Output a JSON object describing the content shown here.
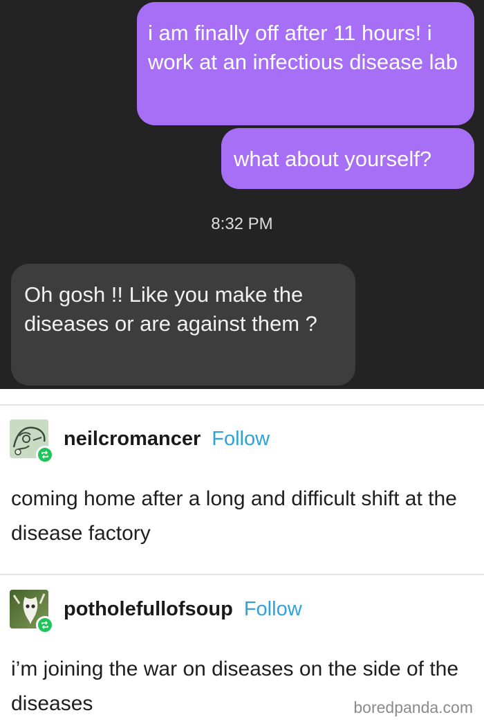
{
  "chat": {
    "messages": [
      {
        "direction": "sent",
        "text": "i am finally off after 11 hours! i work at an infectious disease lab"
      },
      {
        "direction": "sent",
        "text": "what about yourself?"
      },
      {
        "direction": "received",
        "text": "Oh gosh !! Like you make the diseases or are against them ?"
      }
    ],
    "timestamp": "8:32 PM",
    "colors": {
      "sent_bubble": "#a66ff5",
      "received_bubble": "#3d3d3d",
      "background": "#232323"
    }
  },
  "posts": [
    {
      "username": "neilcromancer",
      "follow_label": "Follow",
      "avatar_icon": "anime-character-avatar-icon",
      "text": "coming home after a long and difficult shift at the disease factory"
    },
    {
      "username": "potholefullofsoup",
      "follow_label": "Follow",
      "avatar_icon": "animal-skull-avatar-icon",
      "text": "i’m joining the war on diseases on the side of the diseases"
    }
  ],
  "watermark": "boredpanda.com",
  "colors": {
    "follow": "#2fa2d9",
    "reblog_badge": "#1fc45a"
  }
}
